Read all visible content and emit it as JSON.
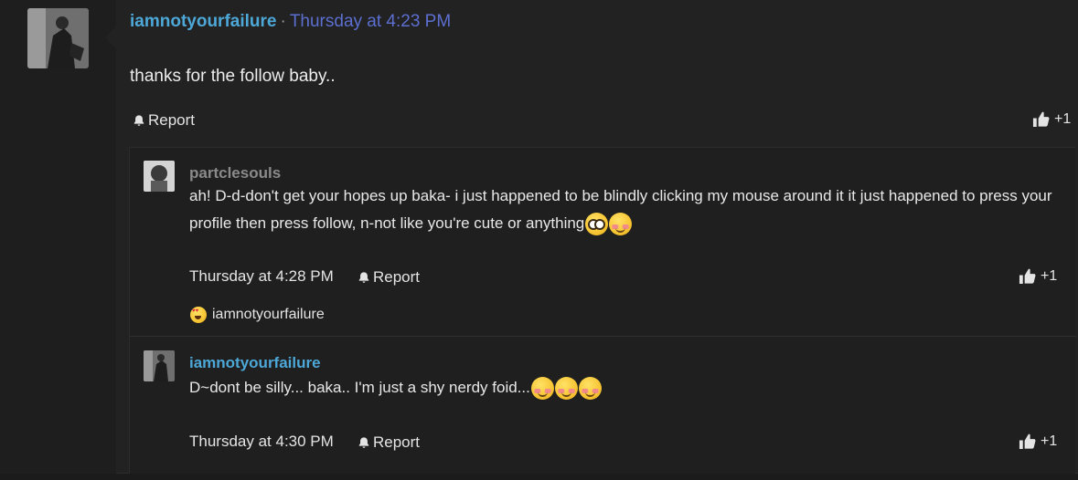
{
  "post": {
    "username": "iamnotyourfailure",
    "separator": "·",
    "timestamp": "Thursday at 4:23 PM",
    "message": "thanks for the follow baby..",
    "report_label": "Report",
    "like_label": "+1"
  },
  "replies": [
    {
      "username": "partclesouls",
      "text": "ah! D-d-don't get your hopes up baka- i just happened to be blindly clicking my mouse around it it just happened to press your profile then press follow, n-not like you're cute or anything",
      "emojis": [
        "flushed-face",
        "smiling-face-with-blush"
      ],
      "timestamp": "Thursday at 4:28 PM",
      "report_label": "Report",
      "like_label": "+1",
      "reaction": {
        "emoji": "heart-eyes",
        "username": "iamnotyourfailure"
      }
    },
    {
      "username": "iamnotyourfailure",
      "text": "D~dont be silly... baka.. I'm just a shy nerdy foid...",
      "emojis": [
        "smiling-face-with-blush",
        "smiling-face-with-blush",
        "smiling-face-with-blush"
      ],
      "timestamp": "Thursday at 4:30 PM",
      "report_label": "Report",
      "like_label": "+1"
    }
  ],
  "colors": {
    "username": "#4da8d8",
    "timestamp": "#5c6fd0",
    "background": "#222222"
  }
}
